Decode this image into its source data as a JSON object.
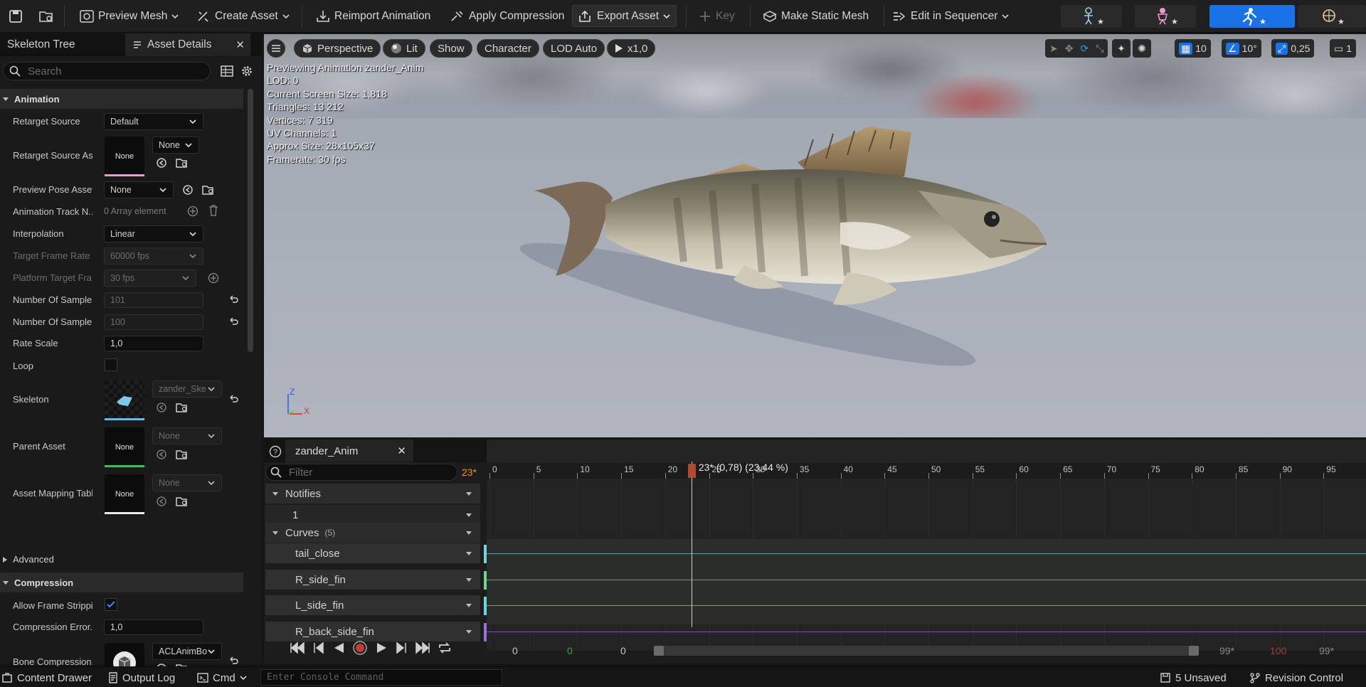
{
  "toolbar": {
    "preview_mesh": "Preview Mesh",
    "create_asset": "Create Asset",
    "reimport_animation": "Reimport Animation",
    "apply_compression": "Apply Compression",
    "export_asset": "Export Asset",
    "key": "Key",
    "make_static_mesh": "Make Static Mesh",
    "edit_in_sequencer": "Edit in Sequencer",
    "modes": [
      "skeleton-mode",
      "mesh-mode",
      "animation-mode",
      "physics-mode"
    ],
    "active_mode_color": "#1a72e8"
  },
  "left_panel": {
    "tabs": [
      "Skeleton Tree",
      "Asset Details"
    ],
    "search_placeholder": "Search",
    "sections": {
      "animation": "Animation",
      "advanced": "Advanced",
      "compression": "Compression"
    },
    "props": {
      "retarget_source": {
        "label": "Retarget Source",
        "value": "Default"
      },
      "retarget_source_asset": {
        "label": "Retarget Source As...",
        "thumb": "None",
        "value": "None"
      },
      "preview_pose_asset": {
        "label": "Preview Pose Asset",
        "value": "None"
      },
      "animation_track_names": {
        "label": "Animation Track N...",
        "value": "0 Array element"
      },
      "interpolation": {
        "label": "Interpolation",
        "value": "Linear"
      },
      "target_frame_rate": {
        "label": "Target Frame Rate",
        "value": "60000 fps"
      },
      "platform_target_frame_rate": {
        "label": "Platform Target Fra...",
        "value": "30 fps"
      },
      "number_of_sampled_keys": {
        "label": "Number Of Sample...",
        "value": "101"
      },
      "number_of_sampled_frames": {
        "label": "Number Of Sample...",
        "value": "100"
      },
      "rate_scale": {
        "label": "Rate Scale",
        "value": "1,0"
      },
      "loop": {
        "label": "Loop"
      },
      "skeleton": {
        "label": "Skeleton",
        "value": "zander_Ske"
      },
      "parent_asset": {
        "label": "Parent Asset",
        "thumb": "None",
        "value": "None"
      },
      "asset_mapping_table": {
        "label": "Asset Mapping Table",
        "thumb": "None",
        "value": "None"
      },
      "allow_frame_stripping": {
        "label": "Allow Frame Strippi..."
      },
      "compression_error": {
        "label": "Compression Error...",
        "value": "1,0"
      },
      "bone_compression": {
        "label": "Bone Compression...",
        "value": "ACLAnimBo"
      }
    }
  },
  "viewport": {
    "perspective": "Perspective",
    "lit": "Lit",
    "show": "Show",
    "character": "Character",
    "lod": "LOD Auto",
    "play_rate": "x1,0",
    "grid_snap": "10",
    "rot_snap": "10°",
    "scale_snap": "0,25",
    "cam_speed": "1",
    "stats": [
      "Previewing Animation zander_Anim",
      "LOD: 0",
      "Current Screen Size: 1,818",
      "Triangles: 13 212",
      "Vertices: 7 319",
      "UV Channels: 1",
      "Approx Size: 28x105x37",
      "Framerate: 30 fps"
    ],
    "axis_z": "Z",
    "axis_x": "X"
  },
  "anim_panel": {
    "tab": "zander_Anim",
    "filter_placeholder": "Filter",
    "current_frame": "23*",
    "scrub_label": "23* (0,78) (23,44 %)",
    "notifies": "Notifies",
    "notify_track": "1",
    "curves": "Curves",
    "curves_count": "(5)",
    "curve_tracks": [
      {
        "name": "tail_close",
        "color": "#6fd3e0"
      },
      {
        "name": "R_side_fin",
        "color": "#6fd38a"
      },
      {
        "name": "L_side_fin",
        "color": "#6fd3e0"
      },
      {
        "name": "R_back_side_fin",
        "color": "#9a6fe0"
      }
    ],
    "ticks": [
      "0",
      "5",
      "10",
      "15",
      "20",
      "25",
      "30",
      "35",
      "40",
      "45",
      "50",
      "55",
      "60",
      "65",
      "70",
      "75",
      "80",
      "85",
      "90",
      "95"
    ],
    "bottom": {
      "start": "0",
      "green": "0",
      "mid": "0",
      "end_a": "99*",
      "end_red": "100",
      "end_b": "99*"
    },
    "progress": 0.23
  },
  "status": {
    "content_drawer": "Content Drawer",
    "output_log": "Output Log",
    "cmd": "Cmd",
    "console_placeholder": "Enter Console Command",
    "unsaved": "5 Unsaved",
    "revision_control": "Revision Control"
  }
}
